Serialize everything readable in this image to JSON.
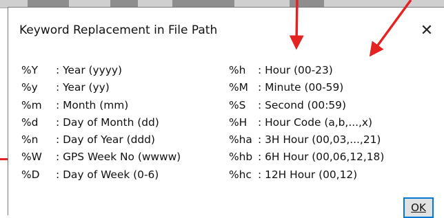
{
  "dialog": {
    "title": "Keyword Replacement in File Path",
    "close_glyph": "✕",
    "ok_label": "OK"
  },
  "keywords_left": [
    {
      "key": "%Y",
      "desc": ": Year (yyyy)"
    },
    {
      "key": "%y",
      "desc": ": Year (yy)"
    },
    {
      "key": "%m",
      "desc": ": Month (mm)"
    },
    {
      "key": "%d",
      "desc": ": Day of Month (dd)"
    },
    {
      "key": "%n",
      "desc": ": Day of Year (ddd)"
    },
    {
      "key": "%W",
      "desc": ": GPS Week No (wwww)"
    },
    {
      "key": "%D",
      "desc": ": Day of Week (0-6)"
    }
  ],
  "keywords_right": [
    {
      "key": "%h",
      "desc": ": Hour (00-23)"
    },
    {
      "key": "%M",
      "desc": ": Minute (00-59)"
    },
    {
      "key": "%S",
      "desc": ": Second (00:59)"
    },
    {
      "key": "%H",
      "desc": ": Hour Code (a,b,...,x)"
    },
    {
      "key": "%ha",
      "desc": ": 3H Hour (00,03,...,21)"
    },
    {
      "key": "%hb",
      "desc": ": 6H Hour (00,06,12,18)"
    },
    {
      "key": "%hc",
      "desc": ": 12H Hour (00,12)"
    }
  ],
  "colors": {
    "annotation_red": "#e32222",
    "button_focus": "#0078d7"
  }
}
